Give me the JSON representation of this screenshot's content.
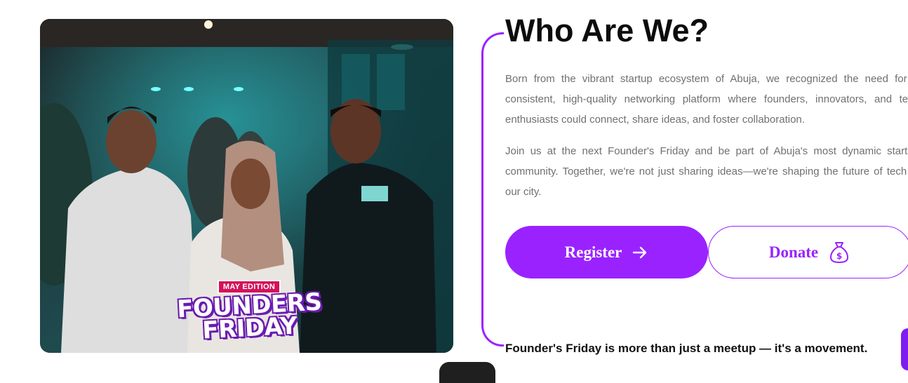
{
  "photo": {
    "badge_edition": "MAY EDITION",
    "badge_line1": "FOUNDERS",
    "badge_line2": "FRIDAY"
  },
  "about": {
    "heading": "Who Are We?",
    "paragraph1": "Born from the vibrant startup ecosystem of Abuja, we recognized the need for a consistent, high-quality networking platform where founders, innovators, and tech enthusiasts could connect, share ideas, and foster collaboration.",
    "paragraph2": "Join us at the next Founder's Friday and be part of Abuja's most dynamic startup community. Together, we're not just sharing ideas—we're shaping the future of tech in our city.",
    "register_label": "Register",
    "donate_label": "Donate",
    "tagline": "Founder's Friday is more than just a meetup — it's a movement."
  },
  "colors": {
    "accent": "#9a22ff",
    "heading": "#0c0c0c",
    "body_text": "#707070"
  },
  "icons": {
    "register": "arrow-right-icon",
    "donate": "money-bag-icon"
  }
}
